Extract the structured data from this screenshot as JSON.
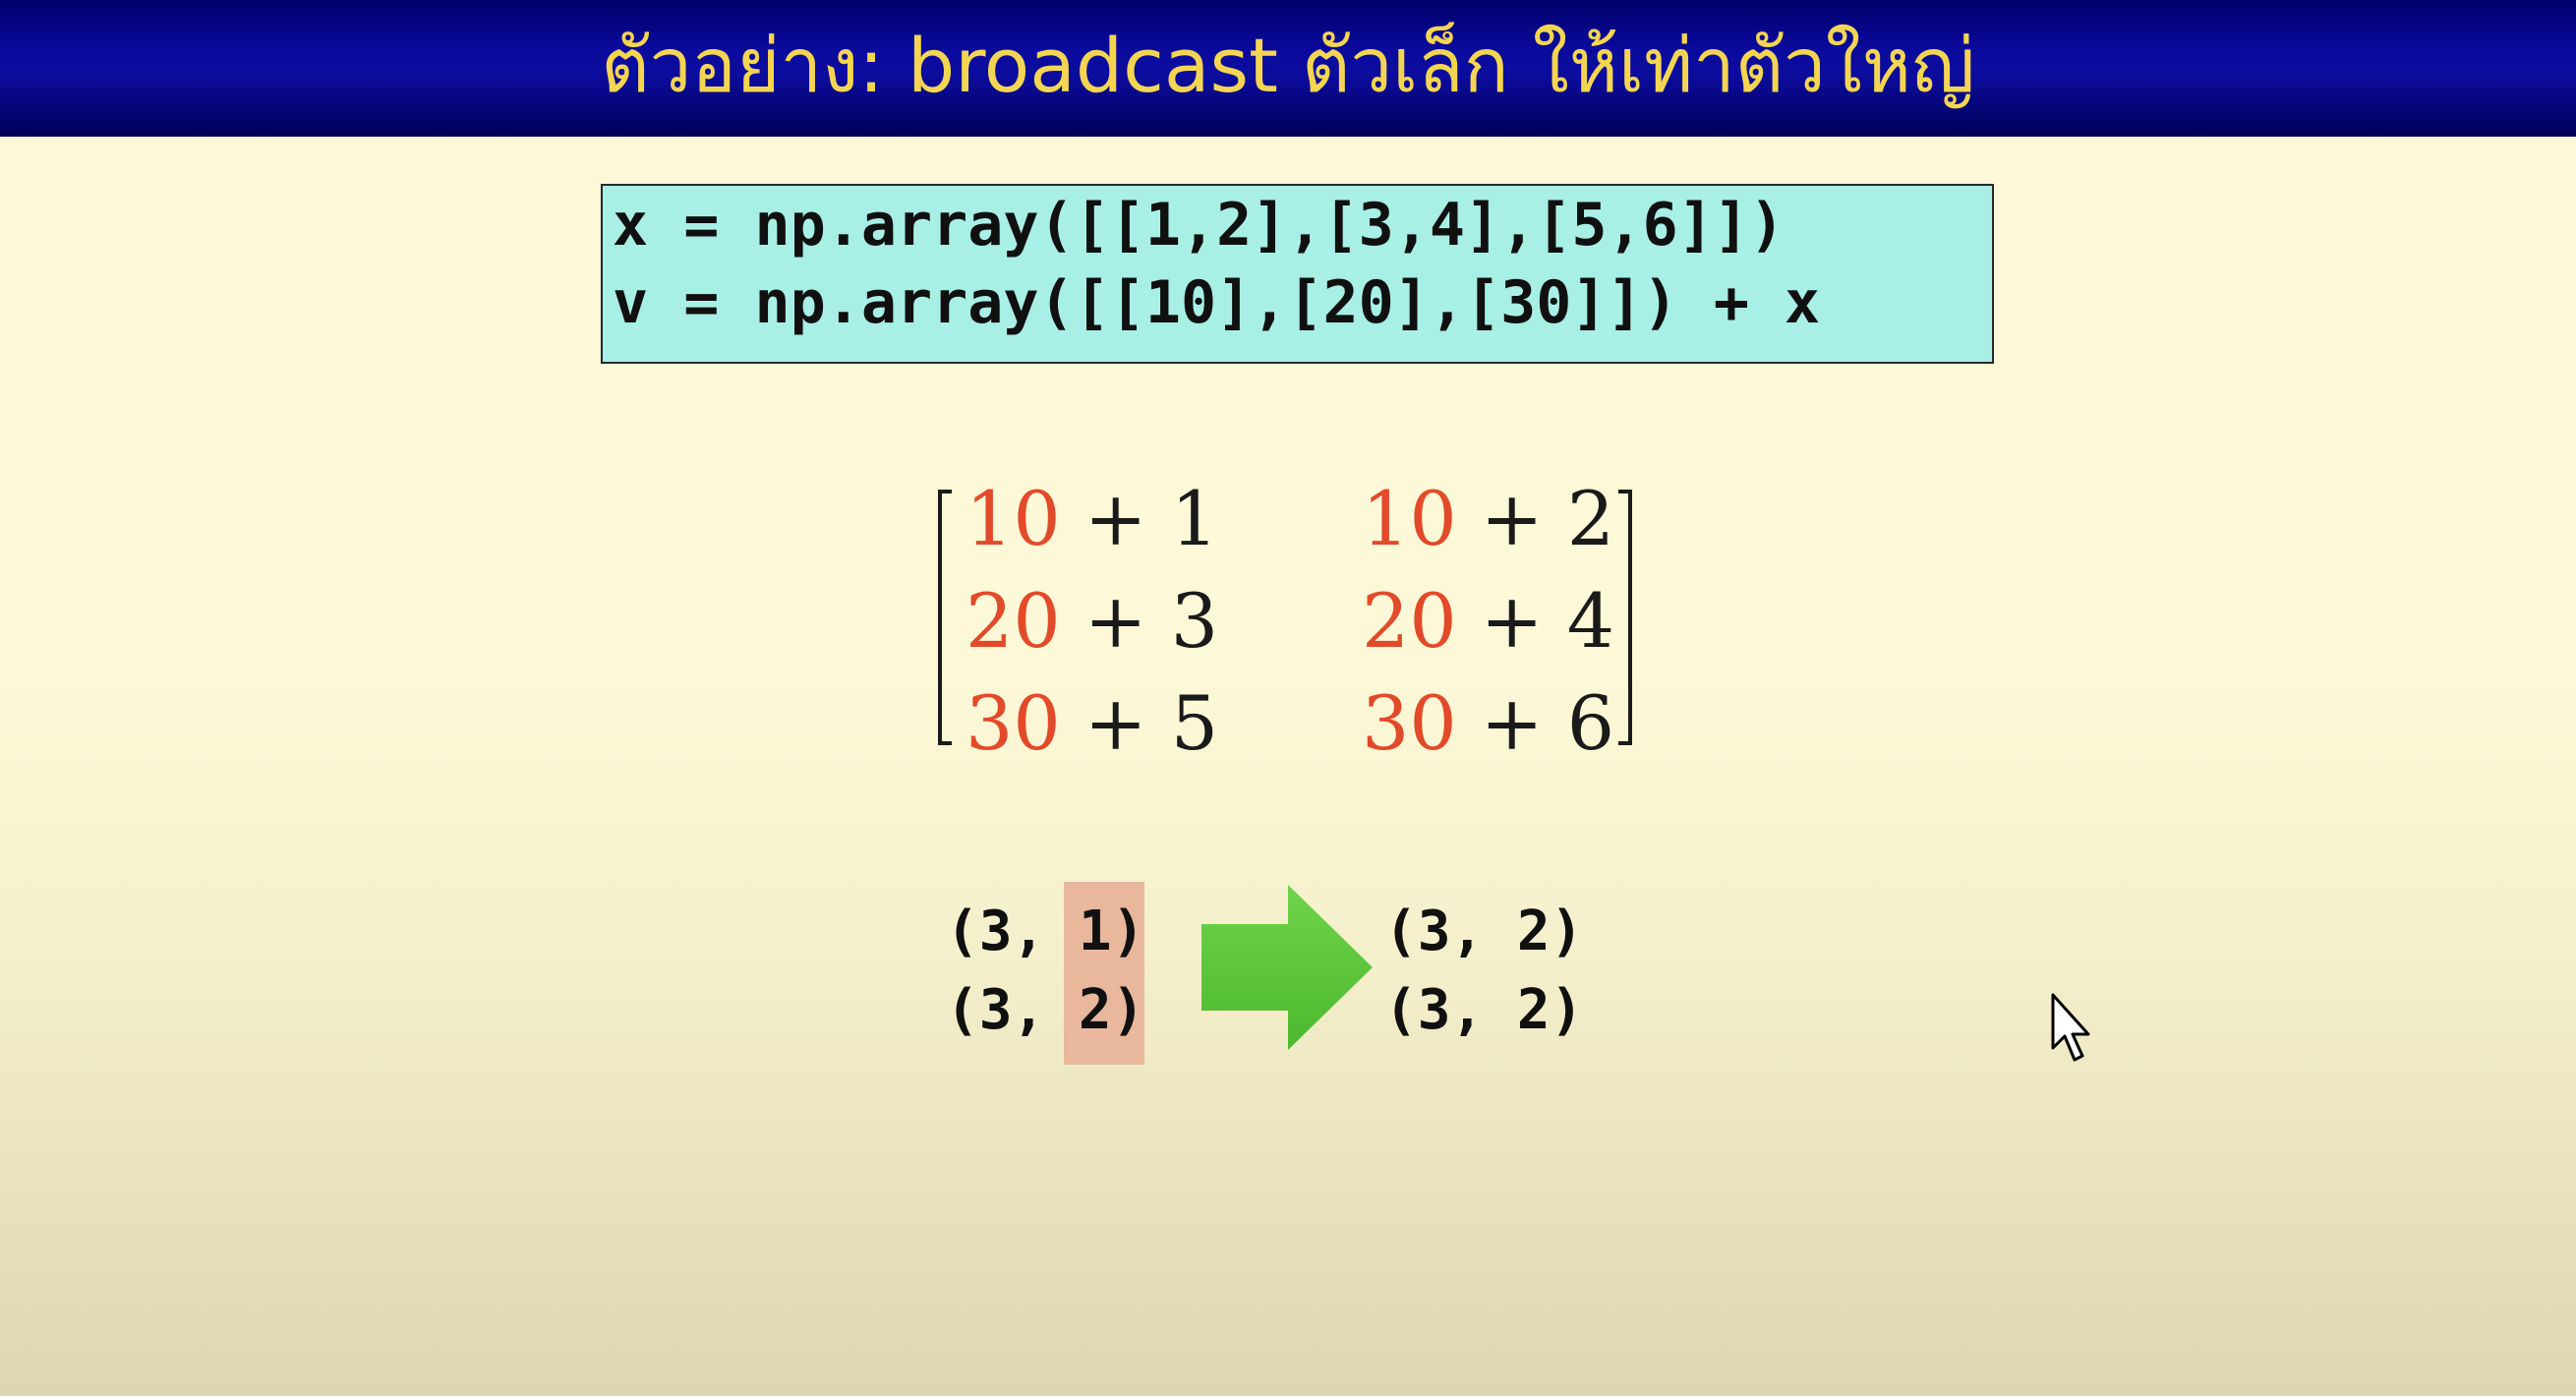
{
  "slide": {
    "title": "ตัวอย่าง: broadcast ตัวเล็ก ให้เท่าตัวใหญ่",
    "code": [
      "x = np.array([[1,2],[3,4],[5,6]])",
      "v = np.array([[10],[20],[30]]) + x"
    ],
    "matrix": [
      [
        {
          "a": "10",
          "op": "+",
          "b": "1"
        },
        {
          "a": "10",
          "op": "+",
          "b": "2"
        }
      ],
      [
        {
          "a": "20",
          "op": "+",
          "b": "3"
        },
        {
          "a": "20",
          "op": "+",
          "b": "4"
        }
      ],
      [
        {
          "a": "30",
          "op": "+",
          "b": "5"
        },
        {
          "a": "30",
          "op": "+",
          "b": "6"
        }
      ]
    ],
    "shapes_before": [
      "(3, 1)",
      "(3, 2)"
    ],
    "shapes_after": [
      "(3, 2)",
      "(3, 2)"
    ]
  },
  "colors": {
    "title_text": "#f4d552",
    "title_bar": "#0a0a9c",
    "code_bg": "#a8efe6",
    "broadcast_value": "#e24a2a",
    "highlight": "#e8b79c",
    "arrow": "#5dc83c"
  },
  "icons": {
    "arrow": "right-arrow-icon",
    "cursor": "mouse-pointer-icon"
  }
}
